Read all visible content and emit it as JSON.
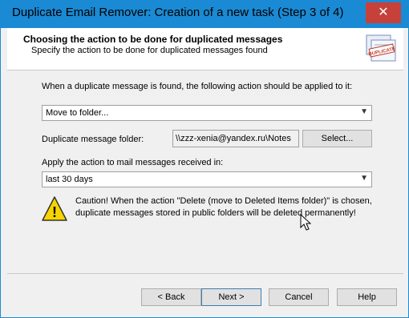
{
  "window": {
    "title": "Duplicate Email Remover: Creation of a new task (Step 3 of 4)",
    "close_glyph": "✕"
  },
  "header": {
    "title": "Choosing the action to be done for duplicated messages",
    "subtitle": "Specify the action to be done for duplicated messages found",
    "stamp_text": "DUPLICATE"
  },
  "form": {
    "action_prompt": "When a duplicate message is found, the following action should be applied to it:",
    "action_value": "Move to folder...",
    "folder_label": "Duplicate message folder:",
    "folder_value": "\\\\zzz-xenia@yandex.ru\\Notes",
    "select_button": "Select...",
    "apply_label": "Apply the action to mail messages received in:",
    "apply_value": "last 30 days"
  },
  "warning": {
    "icon_glyph": "!",
    "line1": "Caution! When the action \"Delete (move to Deleted Items folder)\" is chosen,",
    "line2": "duplicate messages stored in public folders will be deleted permanently!"
  },
  "buttons": {
    "back": "< Back",
    "next": "Next >",
    "cancel": "Cancel",
    "help": "Help"
  },
  "icons": {
    "dropdown_arrow": "▼"
  }
}
